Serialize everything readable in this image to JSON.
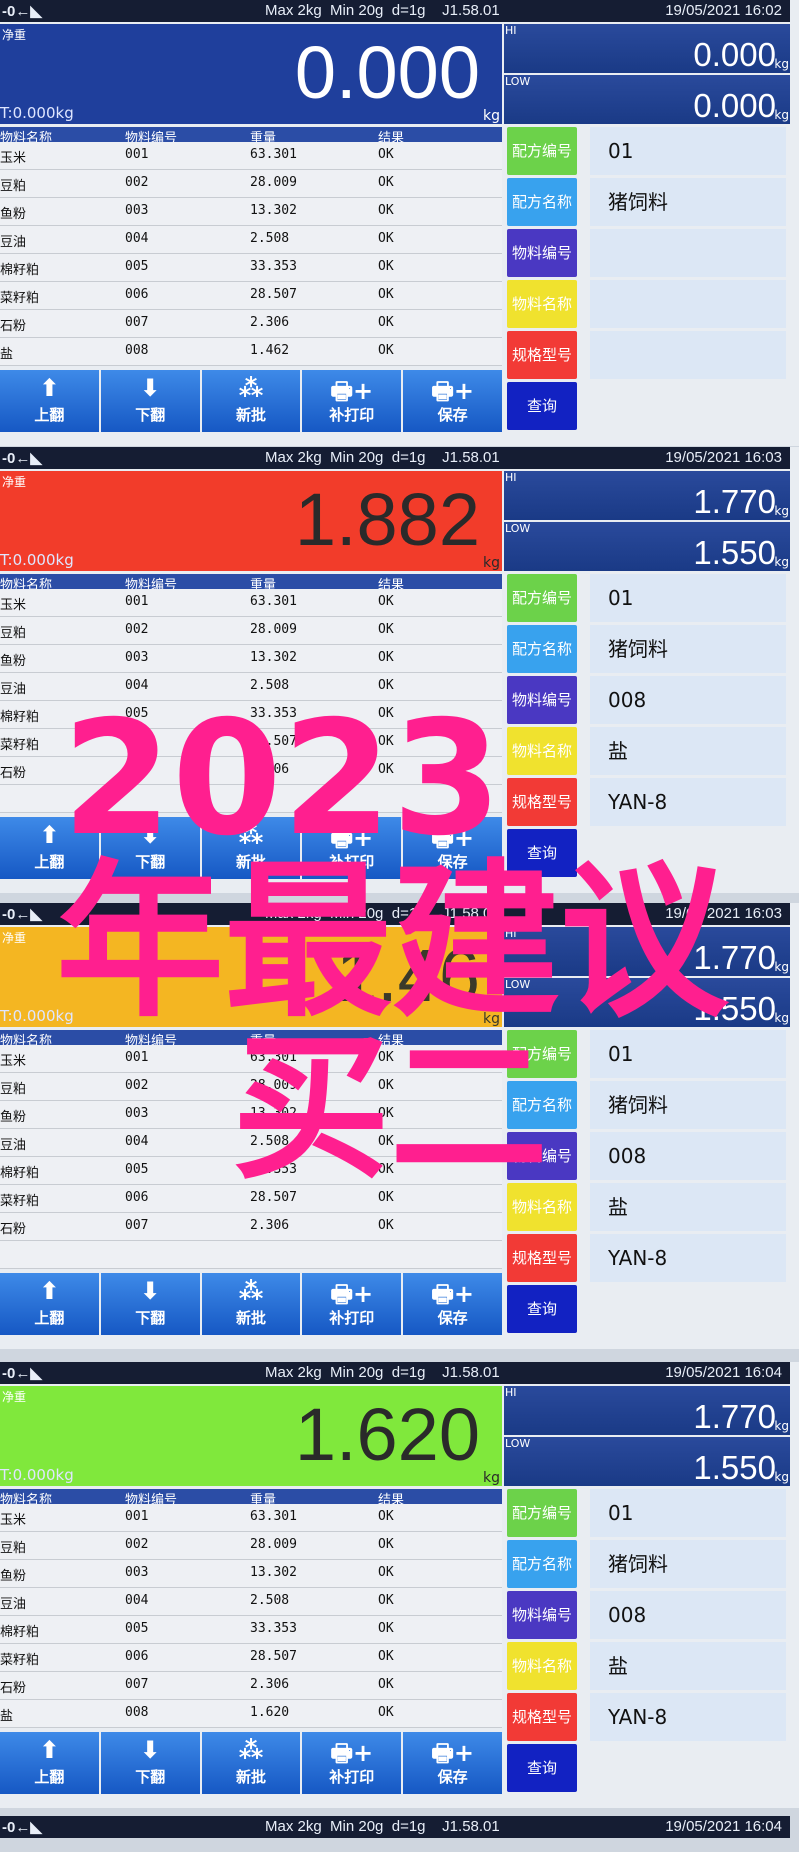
{
  "common": {
    "status_icons": "-0←◣",
    "specs": "Max 2kg  Min 20g  d=1g    J1.58.01",
    "net_label": "净重",
    "tare": "T:0.000kg",
    "unit": "kg",
    "hi_label": "HI",
    "low_label": "LOW",
    "columns": [
      "物料名称",
      "物料编号",
      "重量",
      "结果"
    ],
    "buttons": [
      {
        "label": "上翻",
        "icon": "arrow-up-icon"
      },
      {
        "label": "下翻",
        "icon": "arrow-down-icon"
      },
      {
        "label": "新批",
        "icon": "batch-icon"
      },
      {
        "label": "补打印",
        "icon": "printer-plus-icon"
      },
      {
        "label": "保存",
        "icon": "printer-plus-icon"
      }
    ],
    "side_labels": [
      "配方编号",
      "配方名称",
      "物料编号",
      "物料名称",
      "规格型号",
      "查询"
    ],
    "side_colors": [
      "#6cd24a",
      "#38a2ee",
      "#4a38c2",
      "#f0e22e",
      "#f23a36",
      "#1222c2"
    ]
  },
  "panels": [
    {
      "datetime": "19/05/2021  16:02",
      "weight": "0.000",
      "display_color": "#1f3f9c",
      "weight_color": "#ffffff",
      "hi": "0.000",
      "low": "0.000",
      "rows": [
        [
          "玉米",
          "001",
          "63.301",
          "OK"
        ],
        [
          "豆粕",
          "002",
          "28.009",
          "OK"
        ],
        [
          "鱼粉",
          "003",
          "13.302",
          "OK"
        ],
        [
          "豆油",
          "004",
          "2.508",
          "OK"
        ],
        [
          "棉籽粕",
          "005",
          "33.353",
          "OK"
        ],
        [
          "菜籽粕",
          "006",
          "28.507",
          "OK"
        ],
        [
          "石粉",
          "007",
          "2.306",
          "OK"
        ],
        [
          "盐",
          "008",
          "1.462",
          "OK"
        ]
      ],
      "side_values": [
        "01",
        "猪饲料",
        "",
        "",
        ""
      ]
    },
    {
      "datetime": "19/05/2021  16:03",
      "weight": "1.882",
      "display_color": "#f23c2a",
      "weight_color": "#2a2a2a",
      "hi": "1.770",
      "low": "1.550",
      "rows": [
        [
          "玉米",
          "001",
          "63.301",
          "OK"
        ],
        [
          "豆粕",
          "002",
          "28.009",
          "OK"
        ],
        [
          "鱼粉",
          "003",
          "13.302",
          "OK"
        ],
        [
          "豆油",
          "004",
          "2.508",
          "OK"
        ],
        [
          "棉籽粕",
          "005",
          "33.353",
          "OK"
        ],
        [
          "菜籽粕",
          "006",
          "28.507",
          "OK"
        ],
        [
          "石粉",
          "007",
          "2.306",
          "OK"
        ]
      ],
      "side_values": [
        "01",
        "猪饲料",
        "008",
        "盐",
        "YAN-8"
      ]
    },
    {
      "datetime": "19/05/2021  16:03",
      "weight": "1.46",
      "display_color": "#f4b622",
      "weight_color": "#3a3a2a",
      "hi": "1.770",
      "low": "1.550",
      "rows": [
        [
          "玉米",
          "001",
          "63.301",
          "OK"
        ],
        [
          "豆粕",
          "002",
          "28.009",
          "OK"
        ],
        [
          "鱼粉",
          "003",
          "13.302",
          "OK"
        ],
        [
          "豆油",
          "004",
          "2.508",
          "OK"
        ],
        [
          "棉籽粕",
          "005",
          "33.353",
          "OK"
        ],
        [
          "菜籽粕",
          "006",
          "28.507",
          "OK"
        ],
        [
          "石粉",
          "007",
          "2.306",
          "OK"
        ]
      ],
      "side_values": [
        "01",
        "猪饲料",
        "008",
        "盐",
        "YAN-8"
      ]
    },
    {
      "datetime": "19/05/2021  16:04",
      "weight": "1.620",
      "display_color": "#80e83c",
      "weight_color": "#2a2a2a",
      "hi": "1.770",
      "low": "1.550",
      "rows": [
        [
          "玉米",
          "001",
          "63.301",
          "OK"
        ],
        [
          "豆粕",
          "002",
          "28.009",
          "OK"
        ],
        [
          "鱼粉",
          "003",
          "13.302",
          "OK"
        ],
        [
          "豆油",
          "004",
          "2.508",
          "OK"
        ],
        [
          "棉籽粕",
          "005",
          "33.353",
          "OK"
        ],
        [
          "菜籽粕",
          "006",
          "28.507",
          "OK"
        ],
        [
          "石粉",
          "007",
          "2.306",
          "OK"
        ],
        [
          "盐",
          "008",
          "1.620",
          "OK"
        ]
      ],
      "side_values": [
        "01",
        "猪饲料",
        "008",
        "盐",
        "YAN-8"
      ]
    }
  ],
  "footer_header": {
    "datetime": "19/05/2021  16:04"
  },
  "overlay": {
    "line1": "2023",
    "line2": "年最建议",
    "line3": "买二",
    "color": "#ff1f8f"
  }
}
